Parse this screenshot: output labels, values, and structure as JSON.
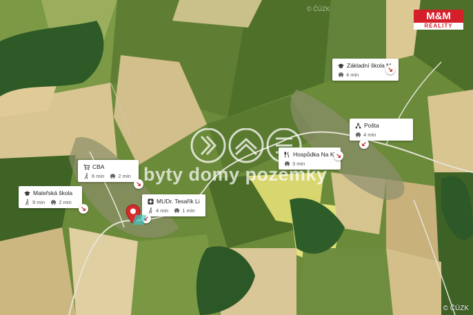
{
  "map": {
    "copyright": "© ČÚZK",
    "copyright_watermark": "© ČÚZK",
    "colors": {
      "field_dark": "#5d7a32",
      "field_light": "#d9c38f",
      "forest": "#2f5a2a",
      "rapeseed": "#d8d86a",
      "road": "#e8e8e0"
    }
  },
  "watermark": {
    "text": "byty domy pozemky"
  },
  "logo": {
    "brand": "M&M",
    "sub": "REALITY",
    "color": "#d4202b"
  },
  "pois": [
    {
      "title": "Základní škola M...",
      "icon": "school-icon",
      "walk": "",
      "car": "4 min"
    },
    {
      "title": "Pošta",
      "icon": "post-office-icon",
      "walk": "",
      "car": "4 min"
    },
    {
      "title": "Hospůdka Na Kříž...",
      "icon": "restaurant-icon",
      "walk": "",
      "car": "3 min"
    },
    {
      "title": "CBA",
      "icon": "shop-icon",
      "walk": "6 min",
      "car": "2 min"
    },
    {
      "title": "Mateřská škola",
      "icon": "school-icon",
      "walk": "9 min",
      "car": "2 min"
    },
    {
      "title": "MUDr. Tesařík Lib...",
      "icon": "doctor-icon",
      "walk": "4 min",
      "car": "1 min"
    }
  ]
}
